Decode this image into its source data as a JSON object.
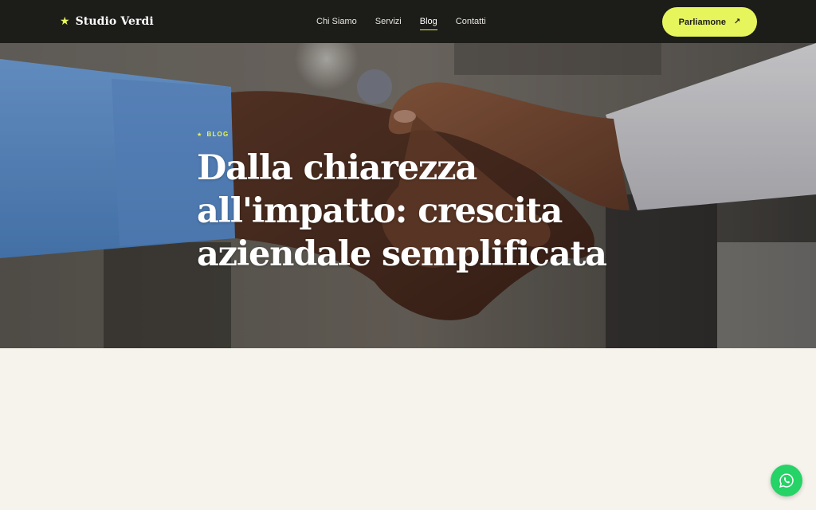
{
  "header": {
    "brand_icon": "star-icon",
    "brand_name": "Studio Verdi",
    "nav": [
      {
        "label": "Chi Siamo",
        "active": false
      },
      {
        "label": "Servizi",
        "active": false
      },
      {
        "label": "Blog",
        "active": true
      },
      {
        "label": "Contatti",
        "active": false
      }
    ],
    "cta_label": "Parliamone",
    "cta_icon": "arrow-up-right-icon"
  },
  "hero": {
    "image": "handshake-photo",
    "eyebrow": "BLOG",
    "eyebrow_icon": "star-icon",
    "title": "Dalla chiarezza all'impatto: crescita aziendale semplificata"
  },
  "floating": {
    "whatsapp_icon": "whatsapp-icon"
  },
  "colors": {
    "accent": "#e6f55b",
    "header_bg": "#1c1c19",
    "page_bg": "#f6f3ec",
    "whatsapp": "#25d366"
  }
}
